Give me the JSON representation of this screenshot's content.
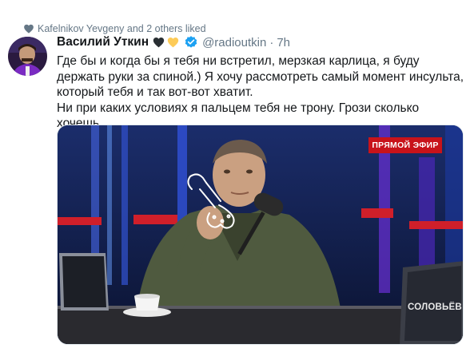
{
  "social_context": {
    "text": "Kafelnikov Yevgeny and 2 others liked"
  },
  "tweet": {
    "display_name": "Василий Уткин",
    "emojis": [
      "black-heart-icon",
      "yellow-heart-icon"
    ],
    "verified_icon": "verified-badge-icon",
    "handle": "@radioutkin",
    "separator": "·",
    "time": "7h",
    "text_lines": [
      "Где бы и когда бы я тебя ни встретил, мерзкая карлица, я буду держать руки за спиной.) Я хочу рассмотреть самый момент инсульта, который тебя и так вот-вот хватит.",
      "Ни при каких условиях я пальцем тебя не трону. Грози сколько хочешь."
    ]
  },
  "media": {
    "live_badge": "ПРЯМОЙ ЭФИР",
    "laptop_logo": "СОЛОВЬЁВ"
  },
  "colors": {
    "secondary_text": "#657786",
    "verified_blue": "#1da1f2",
    "live_red": "#c8131a",
    "liked_heart": "#657786"
  }
}
